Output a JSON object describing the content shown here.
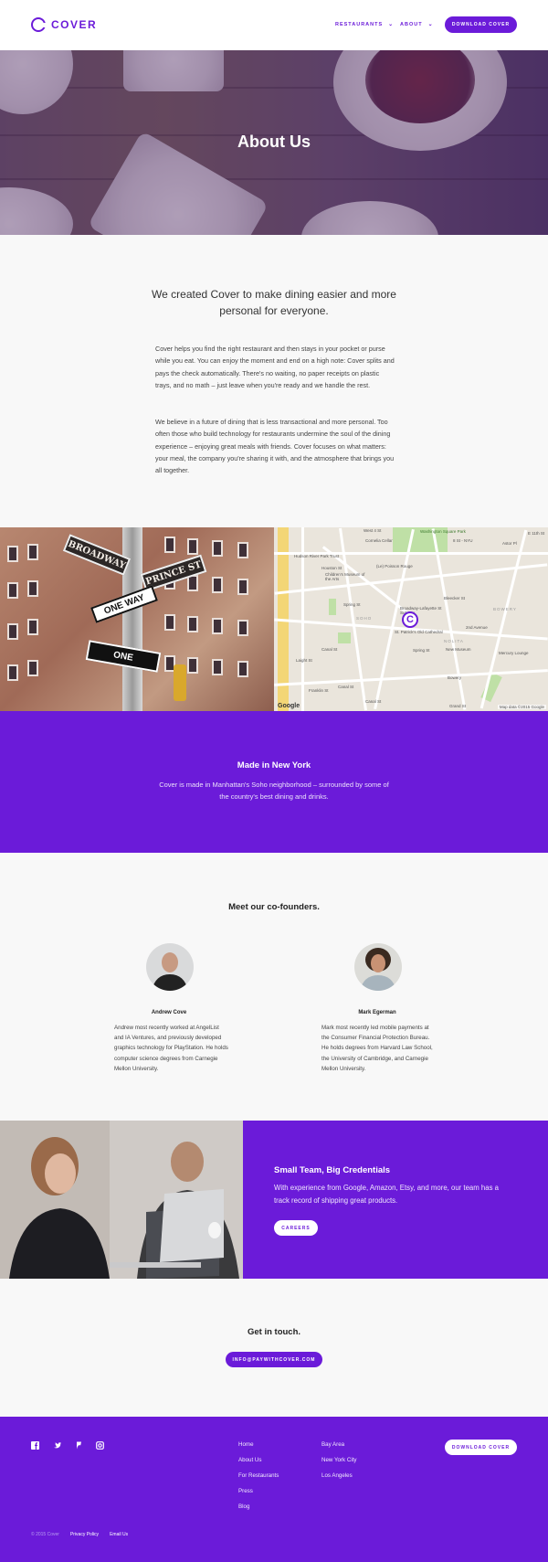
{
  "brand": {
    "name": "COVER",
    "accent": "#6b1bd9"
  },
  "header": {
    "nav": [
      {
        "label": "RESTAURANTS"
      },
      {
        "label": "ABOUT"
      }
    ],
    "cta": "DOWNLOAD COVER"
  },
  "hero": {
    "title": "About Us"
  },
  "intro": {
    "lead": "We created Cover to make dining easier and more personal for everyone.",
    "paragraphs": [
      "Cover helps you find the right restaurant and then stays in your pocket or purse while you eat. You can enjoy the moment and end on a high note: Cover splits and pays the check automatically. There's no waiting, no paper receipts on plastic trays, and no math – just leave when you're ready and we handle the rest.",
      "We believe in a future of dining that is less transactional and more personal. Too often those who build technology for restaurants undermine the soul of the dining experience – enjoying great meals with friends. Cover focuses on what matters: your meal, the company you're sharing it with, and the atmosphere that brings you all together."
    ]
  },
  "street_signs": {
    "top": "BROADWAY",
    "cross": "PRINCE ST",
    "oneway": "ONE WAY",
    "one": "ONE"
  },
  "map": {
    "labels": [
      "West 4 St",
      "Washington Square Park",
      "Cornelia Cellar",
      "8 St - NYU",
      "Astor Pl",
      "E 11th St",
      "Hudson River Park Trust",
      "Houston St",
      "Children's Museum of the Arts",
      "(Le) Poisson Rouge",
      "Spring St",
      "Bleecker St",
      "Broadway-Lafayette St Subway",
      "St. Patrick's Old Cathedral",
      "2nd Avenue",
      "Canal St",
      "Spring St",
      "New Museum",
      "Mercury Lounge",
      "Laight St",
      "Canal St",
      "Bowery",
      "Franklin St",
      "Canal St",
      "Grand St",
      "SOHO",
      "NOLITA",
      "BOWERY"
    ],
    "google": "Google",
    "credit": "Map data ©2015 Google",
    "pin": "C"
  },
  "ny": {
    "title": "Made in New York",
    "text": "Cover is made in Manhattan's Soho neighborhood – surrounded by some of the country's best dining and drinks."
  },
  "cofounders": {
    "title": "Meet our co-founders.",
    "people": [
      {
        "name": "Andrew Cove",
        "bio": "Andrew most recently worked at AngelList and IA Ventures, and previously developed graphics technology for PlayStation. He holds computer science degrees from Carnegie Mellon University."
      },
      {
        "name": "Mark Egerman",
        "bio": "Mark most recently led mobile payments at the Consumer Financial Protection Bureau. He holds degrees from Harvard Law School, the University of Cambridge, and Carnegie Mellon University."
      }
    ]
  },
  "team": {
    "title": "Small Team, Big Credentials",
    "text": "With experience from Google, Amazon, Etsy, and more, our team has a track record of shipping great products.",
    "cta": "CAREERS"
  },
  "contact": {
    "title": "Get in touch.",
    "email": "INFO@PAYWITHCOVER.COM"
  },
  "footer": {
    "social": [
      "facebook-icon",
      "twitter-icon",
      "foursquare-icon",
      "instagram-icon"
    ],
    "col1": [
      "Home",
      "About Us",
      "For Restaurants",
      "Press",
      "Blog"
    ],
    "col2": [
      "Bay Area",
      "New York City",
      "Los Angeles"
    ],
    "cta": "DOWNLOAD COVER",
    "copyright": "© 2015 Cover",
    "links": [
      "Privacy Policy",
      "Email Us"
    ]
  }
}
